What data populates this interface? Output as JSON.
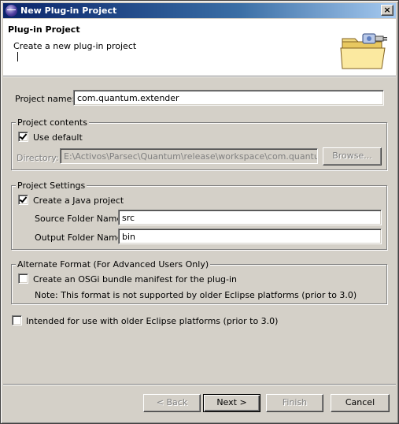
{
  "window": {
    "title": "New Plug-in Project",
    "close_glyph": "×"
  },
  "banner": {
    "title": "Plug-in Project",
    "description": "Create a new plug-in project",
    "graphic": "folder-plugin-icon"
  },
  "project_name": {
    "label": "Project name:",
    "value": "com.quantum.extender"
  },
  "project_contents": {
    "title": "Project contents",
    "use_default_label": "Use default",
    "use_default_checked": true,
    "directory_label": "Directory:",
    "directory_value": "E:\\Activos\\Parsec\\Quantum\\release\\workspace\\com.quantum.exte",
    "browse_label": "Browse..."
  },
  "project_settings": {
    "title": "Project Settings",
    "create_java_label": "Create a Java project",
    "create_java_checked": true,
    "source_folder_label": "Source Folder Name:",
    "source_folder_value": "src",
    "output_folder_label": "Output Folder Name:",
    "output_folder_value": "bin"
  },
  "alternate_format": {
    "title": "Alternate Format (For Advanced Users Only)",
    "osgi_label": "Create an OSGi bundle manifest for the plug-in",
    "osgi_checked": false,
    "note": "Note: This format is not supported by older Eclipse platforms (prior to 3.0)"
  },
  "legacy": {
    "label": "Intended for use with older Eclipse platforms (prior to 3.0)",
    "checked": false
  },
  "buttons": {
    "back": "< Back",
    "next": "Next >",
    "finish": "Finish",
    "cancel": "Cancel"
  }
}
